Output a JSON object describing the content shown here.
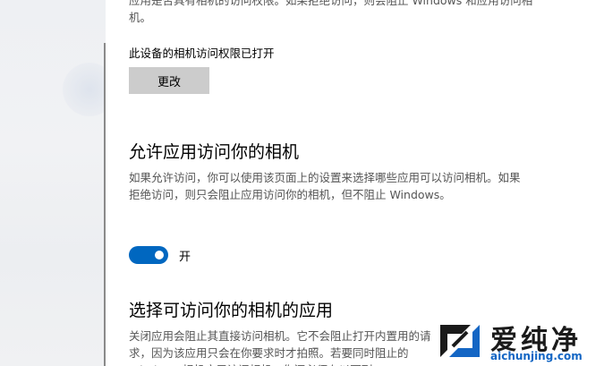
{
  "intro": {
    "partial_text": "应用是否具有相机的访问权限。如果拒绝访问，则会阻止 Windows 和应用访问相机。"
  },
  "device_access": {
    "status_text": "此设备的相机访问权限已打开",
    "change_button_label": "更改"
  },
  "allow_apps": {
    "heading": "允许应用访问你的相机",
    "description": "如果允许访问，你可以使用该页面上的设置来选择哪些应用可以访问相机。如果拒绝访问，则只会阻止应用访问你的相机，但不阻止 Windows。",
    "toggle_state_label": "开",
    "toggle_on": true
  },
  "choose_apps": {
    "heading": "选择可访问你的相机的应用",
    "description": "关闭应用会阻止其直接访问相机。它不会阻止打开内置用的请求，因为该应用只会在你要求时才拍照。若要同时阻止的 Windows 相机应用访问相机，你还必须在以下列"
  },
  "watermark": {
    "title": "爱纯净",
    "url": "aichunjing.com"
  },
  "colors": {
    "accent": "#0067c0",
    "button_bg": "#cccccc",
    "sidebar_bg": "#f0f1f3"
  }
}
